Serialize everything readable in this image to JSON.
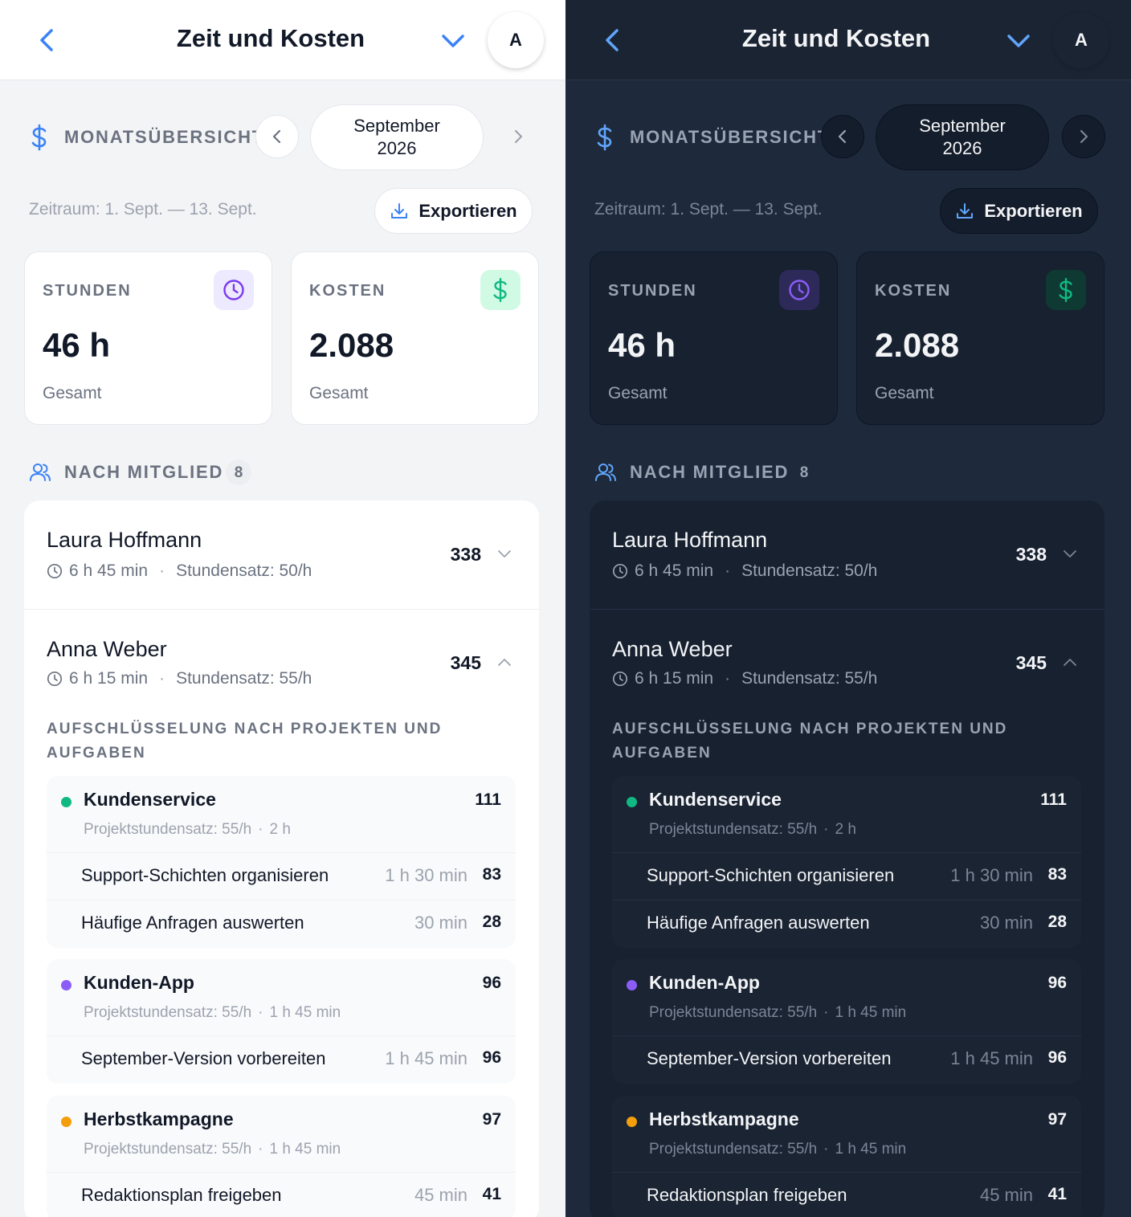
{
  "header": {
    "title": "Zeit und Kosten",
    "avatar_letter": "A"
  },
  "month": {
    "label": "MONATSÜBERSICHT",
    "month_name": "September",
    "year": "2026",
    "range": "Zeitraum: 1. Sept. — 13. Sept.",
    "export_label": "Exportieren"
  },
  "cards": {
    "hours": {
      "label": "STUNDEN",
      "value": "46 h",
      "sub": "Gesamt"
    },
    "costs": {
      "label": "KOSTEN",
      "value": "2.088",
      "sub": "Gesamt"
    }
  },
  "members_section": {
    "label": "NACH MITGLIED",
    "count": "8"
  },
  "members": [
    {
      "name": "Laura Hoffmann",
      "time": "6 h 45 min",
      "rate": "Stundensatz: 50/h",
      "total": "338"
    },
    {
      "name": "Anna Weber",
      "time": "6 h 15 min",
      "rate": "Stundensatz: 55/h",
      "total": "345"
    }
  ],
  "breakdown_title": "AUFSCHLÜSSELUNG NACH PROJEKTEN UND AUFGABEN",
  "projects": [
    {
      "name": "Kundenservice",
      "value": "111",
      "rate": "Projektstundensatz: 55/h",
      "time": "2 h",
      "color": "#10b981",
      "tasks": [
        {
          "name": "Support-Schichten organisieren",
          "time": "1 h 30 min",
          "value": "83"
        },
        {
          "name": "Häufige Anfragen auswerten",
          "time": "30 min",
          "value": "28"
        }
      ]
    },
    {
      "name": "Kunden-App",
      "value": "96",
      "rate": "Projektstundensatz: 55/h",
      "time": "1 h 45 min",
      "color": "#8b5cf6",
      "tasks": [
        {
          "name": "September-Version vorbereiten",
          "time": "1 h 45 min",
          "value": "96"
        }
      ]
    },
    {
      "name": "Herbstkampagne",
      "value": "97",
      "rate": "Projektstundensatz: 55/h",
      "time": "1 h 45 min",
      "color": "#f59e0b",
      "tasks": [
        {
          "name": "Redaktionsplan freigeben",
          "time": "45 min",
          "value": "41"
        }
      ]
    }
  ],
  "colors": {
    "accent": "#3b82f6",
    "purple": "#7c3aed",
    "green": "#10b981",
    "orange": "#f59e0b"
  },
  "icons": [
    "back-chevron-icon",
    "chevron-down-icon",
    "dollar-icon",
    "chevron-left-icon",
    "chevron-right-icon",
    "download-icon",
    "clock-icon",
    "users-icon",
    "chevron-up-icon"
  ]
}
